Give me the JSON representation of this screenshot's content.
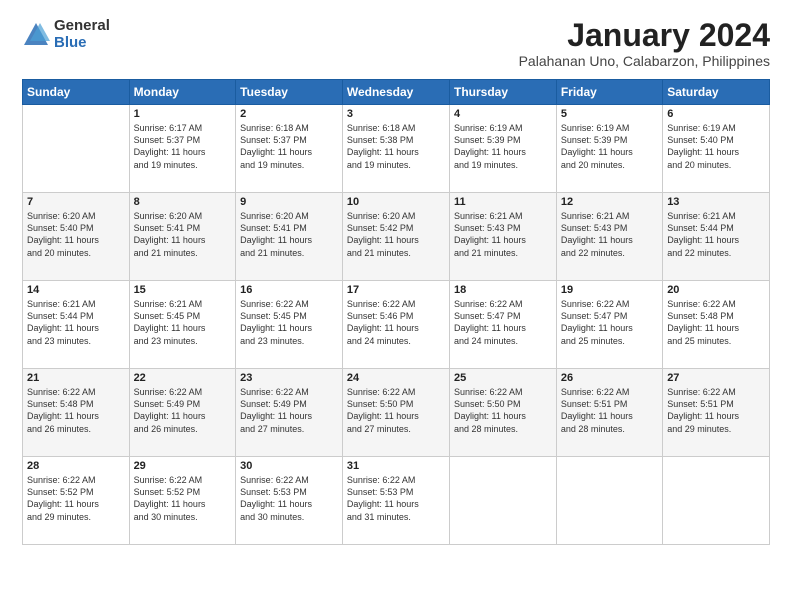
{
  "header": {
    "logo_general": "General",
    "logo_blue": "Blue",
    "title": "January 2024",
    "location": "Palahanan Uno, Calabarzon, Philippines"
  },
  "days_of_week": [
    "Sunday",
    "Monday",
    "Tuesday",
    "Wednesday",
    "Thursday",
    "Friday",
    "Saturday"
  ],
  "weeks": [
    [
      {
        "day": "",
        "info": ""
      },
      {
        "day": "1",
        "info": "Sunrise: 6:17 AM\nSunset: 5:37 PM\nDaylight: 11 hours\nand 19 minutes."
      },
      {
        "day": "2",
        "info": "Sunrise: 6:18 AM\nSunset: 5:37 PM\nDaylight: 11 hours\nand 19 minutes."
      },
      {
        "day": "3",
        "info": "Sunrise: 6:18 AM\nSunset: 5:38 PM\nDaylight: 11 hours\nand 19 minutes."
      },
      {
        "day": "4",
        "info": "Sunrise: 6:19 AM\nSunset: 5:39 PM\nDaylight: 11 hours\nand 19 minutes."
      },
      {
        "day": "5",
        "info": "Sunrise: 6:19 AM\nSunset: 5:39 PM\nDaylight: 11 hours\nand 20 minutes."
      },
      {
        "day": "6",
        "info": "Sunrise: 6:19 AM\nSunset: 5:40 PM\nDaylight: 11 hours\nand 20 minutes."
      }
    ],
    [
      {
        "day": "7",
        "info": "Sunrise: 6:20 AM\nSunset: 5:40 PM\nDaylight: 11 hours\nand 20 minutes."
      },
      {
        "day": "8",
        "info": "Sunrise: 6:20 AM\nSunset: 5:41 PM\nDaylight: 11 hours\nand 21 minutes."
      },
      {
        "day": "9",
        "info": "Sunrise: 6:20 AM\nSunset: 5:41 PM\nDaylight: 11 hours\nand 21 minutes."
      },
      {
        "day": "10",
        "info": "Sunrise: 6:20 AM\nSunset: 5:42 PM\nDaylight: 11 hours\nand 21 minutes."
      },
      {
        "day": "11",
        "info": "Sunrise: 6:21 AM\nSunset: 5:43 PM\nDaylight: 11 hours\nand 21 minutes."
      },
      {
        "day": "12",
        "info": "Sunrise: 6:21 AM\nSunset: 5:43 PM\nDaylight: 11 hours\nand 22 minutes."
      },
      {
        "day": "13",
        "info": "Sunrise: 6:21 AM\nSunset: 5:44 PM\nDaylight: 11 hours\nand 22 minutes."
      }
    ],
    [
      {
        "day": "14",
        "info": "Sunrise: 6:21 AM\nSunset: 5:44 PM\nDaylight: 11 hours\nand 23 minutes."
      },
      {
        "day": "15",
        "info": "Sunrise: 6:21 AM\nSunset: 5:45 PM\nDaylight: 11 hours\nand 23 minutes."
      },
      {
        "day": "16",
        "info": "Sunrise: 6:22 AM\nSunset: 5:45 PM\nDaylight: 11 hours\nand 23 minutes."
      },
      {
        "day": "17",
        "info": "Sunrise: 6:22 AM\nSunset: 5:46 PM\nDaylight: 11 hours\nand 24 minutes."
      },
      {
        "day": "18",
        "info": "Sunrise: 6:22 AM\nSunset: 5:47 PM\nDaylight: 11 hours\nand 24 minutes."
      },
      {
        "day": "19",
        "info": "Sunrise: 6:22 AM\nSunset: 5:47 PM\nDaylight: 11 hours\nand 25 minutes."
      },
      {
        "day": "20",
        "info": "Sunrise: 6:22 AM\nSunset: 5:48 PM\nDaylight: 11 hours\nand 25 minutes."
      }
    ],
    [
      {
        "day": "21",
        "info": "Sunrise: 6:22 AM\nSunset: 5:48 PM\nDaylight: 11 hours\nand 26 minutes."
      },
      {
        "day": "22",
        "info": "Sunrise: 6:22 AM\nSunset: 5:49 PM\nDaylight: 11 hours\nand 26 minutes."
      },
      {
        "day": "23",
        "info": "Sunrise: 6:22 AM\nSunset: 5:49 PM\nDaylight: 11 hours\nand 27 minutes."
      },
      {
        "day": "24",
        "info": "Sunrise: 6:22 AM\nSunset: 5:50 PM\nDaylight: 11 hours\nand 27 minutes."
      },
      {
        "day": "25",
        "info": "Sunrise: 6:22 AM\nSunset: 5:50 PM\nDaylight: 11 hours\nand 28 minutes."
      },
      {
        "day": "26",
        "info": "Sunrise: 6:22 AM\nSunset: 5:51 PM\nDaylight: 11 hours\nand 28 minutes."
      },
      {
        "day": "27",
        "info": "Sunrise: 6:22 AM\nSunset: 5:51 PM\nDaylight: 11 hours\nand 29 minutes."
      }
    ],
    [
      {
        "day": "28",
        "info": "Sunrise: 6:22 AM\nSunset: 5:52 PM\nDaylight: 11 hours\nand 29 minutes."
      },
      {
        "day": "29",
        "info": "Sunrise: 6:22 AM\nSunset: 5:52 PM\nDaylight: 11 hours\nand 30 minutes."
      },
      {
        "day": "30",
        "info": "Sunrise: 6:22 AM\nSunset: 5:53 PM\nDaylight: 11 hours\nand 30 minutes."
      },
      {
        "day": "31",
        "info": "Sunrise: 6:22 AM\nSunset: 5:53 PM\nDaylight: 11 hours\nand 31 minutes."
      },
      {
        "day": "",
        "info": ""
      },
      {
        "day": "",
        "info": ""
      },
      {
        "day": "",
        "info": ""
      }
    ]
  ]
}
